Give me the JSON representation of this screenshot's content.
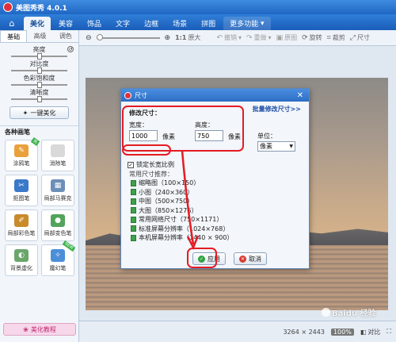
{
  "app": {
    "title": "美图秀秀 4.0.1"
  },
  "tabs": [
    {
      "label": "美化",
      "active": true
    },
    {
      "label": "美容"
    },
    {
      "label": "饰品"
    },
    {
      "label": "文字"
    },
    {
      "label": "边框"
    },
    {
      "label": "场景"
    },
    {
      "label": "拼图"
    },
    {
      "label": "更多功能"
    }
  ],
  "toolbar": {
    "ratio_label": "1:1",
    "orig_label": "原大",
    "undo_label": "撤销",
    "redo_label": "重做",
    "compare_label": "原图",
    "rotate_label": "旋转",
    "crop_label": "裁剪",
    "size_label": "尺寸"
  },
  "left": {
    "subtabs": [
      "基础",
      "高级",
      "调色"
    ],
    "sliders": [
      "亮度",
      "对比度",
      "色彩饱和度",
      "清晰度"
    ],
    "onekey_label": "一键美化",
    "section_title": "各种画笔",
    "tools": [
      {
        "label": "涂鸦笔",
        "icon": "pencil-icon",
        "color": "#e9a23b",
        "hot": "热"
      },
      {
        "label": "消除笔",
        "icon": "eraser-icon",
        "color": "#d9d9d9"
      },
      {
        "label": "抠图笔",
        "icon": "cutout-icon",
        "color": "#3a78c9"
      },
      {
        "label": "局部马赛克",
        "icon": "mosaic-icon",
        "color": "#6c8fb8"
      },
      {
        "label": "局部彩色笔",
        "icon": "color-brush-icon",
        "color": "#c98a2a"
      },
      {
        "label": "局部变色笔",
        "icon": "recolor-icon",
        "color": "#52a35b"
      },
      {
        "label": "背景虚化",
        "icon": "blur-icon",
        "color": "#6aa66a"
      },
      {
        "label": "魔幻笔",
        "icon": "magic-pen-icon",
        "color": "#4a8fd8",
        "hot": "NEW"
      }
    ],
    "tutorial_label": "美化教程"
  },
  "status": {
    "dimensions": "3264 × 2443",
    "compare_label": "对比",
    "zoom_label": "100%"
  },
  "dialog": {
    "title": "尺寸",
    "batch_link": "批量修改尺寸>>",
    "modify_label": "修改尺寸：",
    "width_label": "宽度：",
    "width_value": "1000",
    "height_label": "高度：",
    "height_value": "750",
    "unit_px": "像素",
    "unit_label": "单位：",
    "unit_value": "像素",
    "keep_ratio_label": "锁定长宽比例",
    "keep_ratio_checked": true,
    "preset_title": "常用尺寸推荐：",
    "presets": [
      "缩略图（100×150）",
      "小图（240×360）",
      "中图（500×750）",
      "大图（850×1276）",
      "常用网络尺寸（750×1171）",
      "标准屏幕分辨率（1024×768）",
      "本机屏幕分辨率（1440 × 900）"
    ],
    "ok_label": "应用",
    "cancel_label": "取消"
  },
  "watermark": "Baidu 经验",
  "colors": {
    "titlebar": "#1f67c4",
    "annotation": "#e41b23",
    "accent": "#1d4fa8"
  }
}
